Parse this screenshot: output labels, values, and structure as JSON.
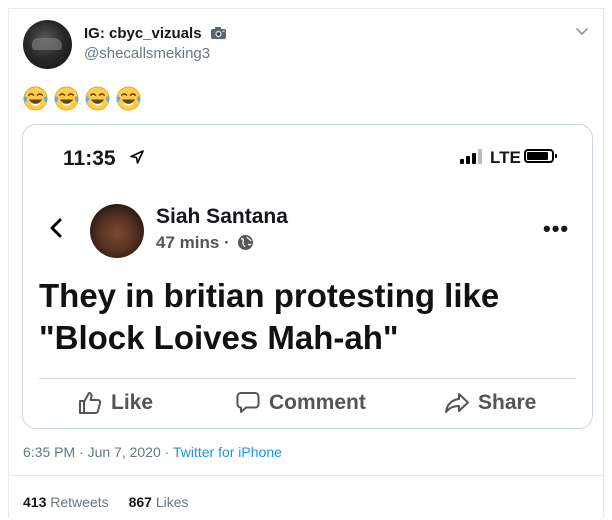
{
  "tweet": {
    "display_name": "IG: cbyc_vizuals",
    "handle": "@shecallsmeking3",
    "emoji_count": 4,
    "emoji_name": "face-with-tears-of-joy",
    "timestamp": "6:35 PM · Jun 7, 2020 · ",
    "source": "Twitter for iPhone",
    "retweets_count": "413",
    "retweets_label": "Retweets",
    "likes_count": "867",
    "likes_label": "Likes"
  },
  "screenshot": {
    "status_time": "11:35",
    "network": "LTE",
    "post": {
      "author": "Siah Santana",
      "age": "47 mins · ",
      "line1": "They in britian protesting like",
      "line2": "\"Block Loives Mah-ah\"",
      "like_label": "Like",
      "comment_label": "Comment",
      "share_label": "Share"
    }
  },
  "colors": {
    "link": "#1b95e0",
    "muted": "#657786",
    "border": "#e6ecf0"
  }
}
